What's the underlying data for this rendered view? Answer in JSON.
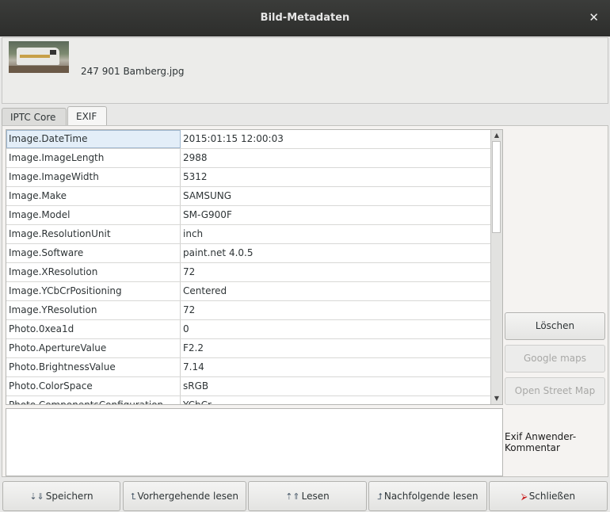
{
  "window": {
    "title": "Bild-Metadaten"
  },
  "header": {
    "filename": "247 901 Bamberg.jpg"
  },
  "tabs": [
    {
      "label": "IPTC Core",
      "active": false
    },
    {
      "label": "EXIF",
      "active": true
    }
  ],
  "table": {
    "rows": [
      {
        "key": "Image.DateTime",
        "value": "2015:01:15 12:00:03"
      },
      {
        "key": "Image.ImageLength",
        "value": "2988"
      },
      {
        "key": "Image.ImageWidth",
        "value": "5312"
      },
      {
        "key": "Image.Make",
        "value": "SAMSUNG"
      },
      {
        "key": "Image.Model",
        "value": "SM-G900F"
      },
      {
        "key": "Image.ResolutionUnit",
        "value": "inch"
      },
      {
        "key": "Image.Software",
        "value": "paint.net 4.0.5"
      },
      {
        "key": "Image.XResolution",
        "value": "72"
      },
      {
        "key": "Image.YCbCrPositioning",
        "value": "Centered"
      },
      {
        "key": "Image.YResolution",
        "value": "72"
      },
      {
        "key": "Photo.0xea1d",
        "value": "0"
      },
      {
        "key": "Photo.ApertureValue",
        "value": "F2.2"
      },
      {
        "key": "Photo.BrightnessValue",
        "value": "7.14"
      },
      {
        "key": "Photo.ColorSpace",
        "value": "sRGB"
      },
      {
        "key": "Photo.ComponentsConfiguration",
        "value": "YCbCr"
      }
    ]
  },
  "side_buttons": {
    "delete": "Löschen",
    "google_maps": "Google maps",
    "osm": "Open Street Map"
  },
  "comment": {
    "label": "Exif Anwender-Kommentar"
  },
  "bottom_buttons": {
    "save": "Speichern",
    "prev": "Vorhergehende lesen",
    "read": "Lesen",
    "next": "Nachfolgende lesen",
    "close": "Schließen"
  }
}
